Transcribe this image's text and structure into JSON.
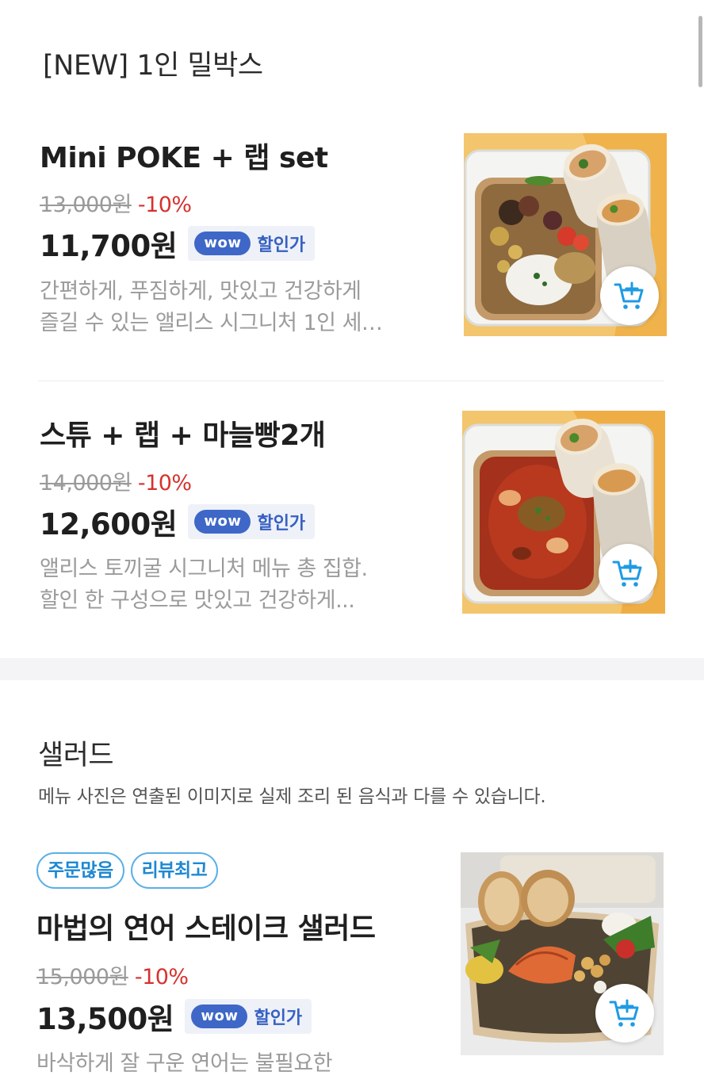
{
  "section1": {
    "title": "[NEW] 1인 밀박스",
    "items": [
      {
        "name": "Mini POKE + 랩 set",
        "original_price": "13,000원",
        "discount": "-10%",
        "sale_price": "11,700원",
        "wow_label": "wow",
        "wow_text": "할인가",
        "desc_line1": "간편하게, 푸짐하게, 맛있고 건강하게",
        "desc_line2": "즐길 수 있는 앨리스 시그니처 1인 세…"
      },
      {
        "name": "스튜 + 랩 + 마늘빵2개",
        "original_price": "14,000원",
        "discount": "-10%",
        "sale_price": "12,600원",
        "wow_label": "wow",
        "wow_text": "할인가",
        "desc_line1": "앨리스 토끼굴 시그니처 메뉴 총 집합.",
        "desc_line2": "할인 한 구성으로 맛있고 건강하게..."
      }
    ]
  },
  "section2": {
    "title": "샐러드",
    "note": "메뉴 사진은 연출된 이미지로 실제 조리 된 음식과 다를 수 있습니다.",
    "items": [
      {
        "tags": [
          "주문많음",
          "리뷰최고"
        ],
        "name": "마법의 연어 스테이크 샐러드",
        "original_price": "15,000원",
        "discount": "-10%",
        "sale_price": "13,500원",
        "wow_label": "wow",
        "wow_text": "할인가",
        "desc_line1": "바삭하게 잘 구운 연어는 불필요한"
      }
    ]
  },
  "icons": {
    "cart_add": "cart-plus-icon"
  },
  "colors": {
    "discount": "#d6322e",
    "wow_pill": "#3e67c7",
    "wow_text": "#3660c2",
    "tag_border": "#5ab0e6",
    "tag_text": "#1e88d2",
    "cart_icon": "#1e9be3"
  }
}
